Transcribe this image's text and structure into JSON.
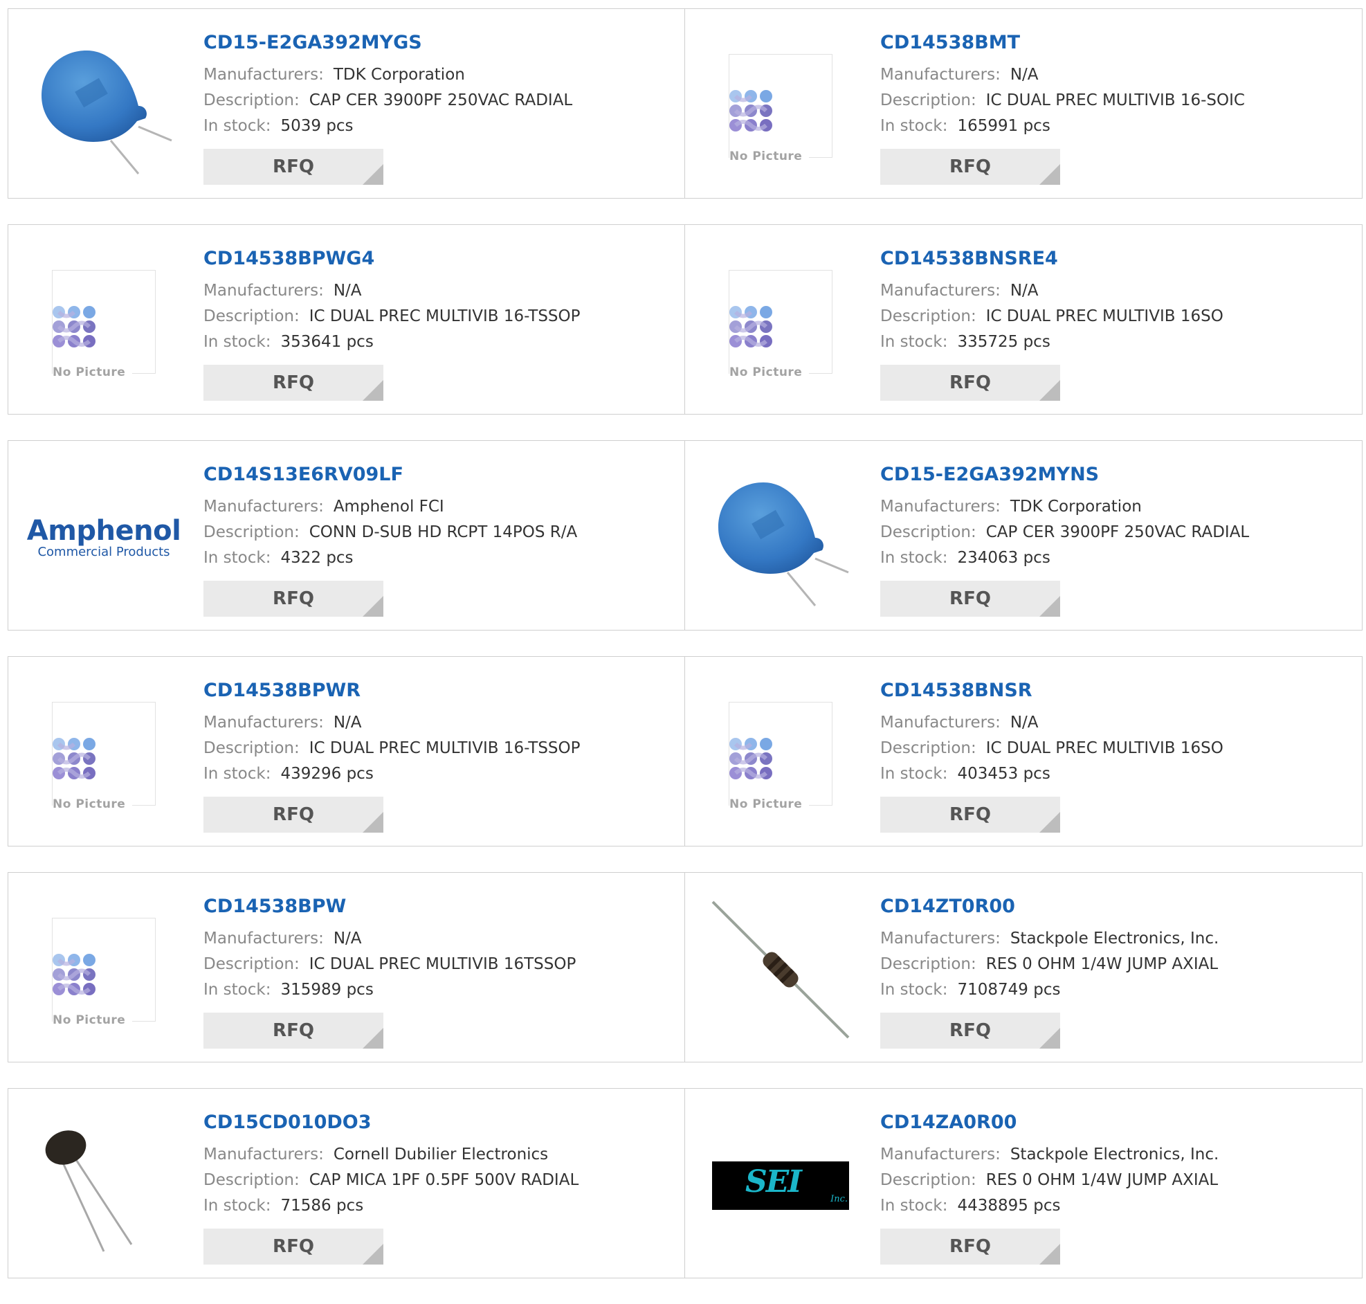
{
  "rfq_label": "RFQ",
  "labels": {
    "manufacturers": "Manufacturers:",
    "description": "Description:",
    "in_stock": "In stock:"
  },
  "no_picture_text": "No Picture",
  "logos": {
    "amphenol_main": "Amphenol",
    "amphenol_sub": "Commercial Products",
    "sei_main": "SEI",
    "sei_sub": "Inc."
  },
  "colors": {
    "title": "#1a63b3",
    "rfq_bg": "#eaeaea",
    "border": "#cfcfcf"
  },
  "products": [
    {
      "part": "CD15-E2GA392MYGS",
      "manufacturer": "TDK Corporation",
      "description": "CAP CER 3900PF 250VAC RADIAL",
      "stock": "5039 pcs",
      "image": "blue-ceramic-capacitor"
    },
    {
      "part": "CD14538BMT",
      "manufacturer": "N/A",
      "description": "IC DUAL PREC MULTIVIB 16-SOIC",
      "stock": "165991 pcs",
      "image": "no-picture"
    },
    {
      "part": "CD14538BPWG4",
      "manufacturer": "N/A",
      "description": "IC DUAL PREC MULTIVIB 16-TSSOP",
      "stock": "353641 pcs",
      "image": "no-picture"
    },
    {
      "part": "CD14538BNSRE4",
      "manufacturer": "N/A",
      "description": "IC DUAL PREC MULTIVIB 16SO",
      "stock": "335725 pcs",
      "image": "no-picture"
    },
    {
      "part": "CD14S13E6RV09LF",
      "manufacturer": "Amphenol FCI",
      "description": "CONN D-SUB HD RCPT 14POS R/A",
      "stock": "4322 pcs",
      "image": "amphenol-logo"
    },
    {
      "part": "CD15-E2GA392MYNS",
      "manufacturer": "TDK Corporation",
      "description": "CAP CER 3900PF 250VAC RADIAL",
      "stock": "234063 pcs",
      "image": "blue-ceramic-capacitor"
    },
    {
      "part": "CD14538BPWR",
      "manufacturer": "N/A",
      "description": "IC DUAL PREC MULTIVIB 16-TSSOP",
      "stock": "439296 pcs",
      "image": "no-picture"
    },
    {
      "part": "CD14538BNSR",
      "manufacturer": "N/A",
      "description": "IC DUAL PREC MULTIVIB 16SO",
      "stock": "403453 pcs",
      "image": "no-picture"
    },
    {
      "part": "CD14538BPW",
      "manufacturer": "N/A",
      "description": "IC DUAL PREC MULTIVIB 16TSSOP",
      "stock": "315989 pcs",
      "image": "no-picture"
    },
    {
      "part": "CD14ZT0R00",
      "manufacturer": "Stackpole Electronics, Inc.",
      "description": "RES 0 OHM 1/4W JUMP AXIAL",
      "stock": "7108749 pcs",
      "image": "axial-resistor"
    },
    {
      "part": "CD15CD010DO3",
      "manufacturer": "Cornell Dubilier Electronics",
      "description": "CAP MICA 1PF 0.5PF 500V RADIAL",
      "stock": "71586 pcs",
      "image": "mica-capacitor"
    },
    {
      "part": "CD14ZA0R00",
      "manufacturer": "Stackpole Electronics, Inc.",
      "description": "RES 0 OHM 1/4W JUMP AXIAL",
      "stock": "4438895 pcs",
      "image": "sei-logo"
    }
  ]
}
